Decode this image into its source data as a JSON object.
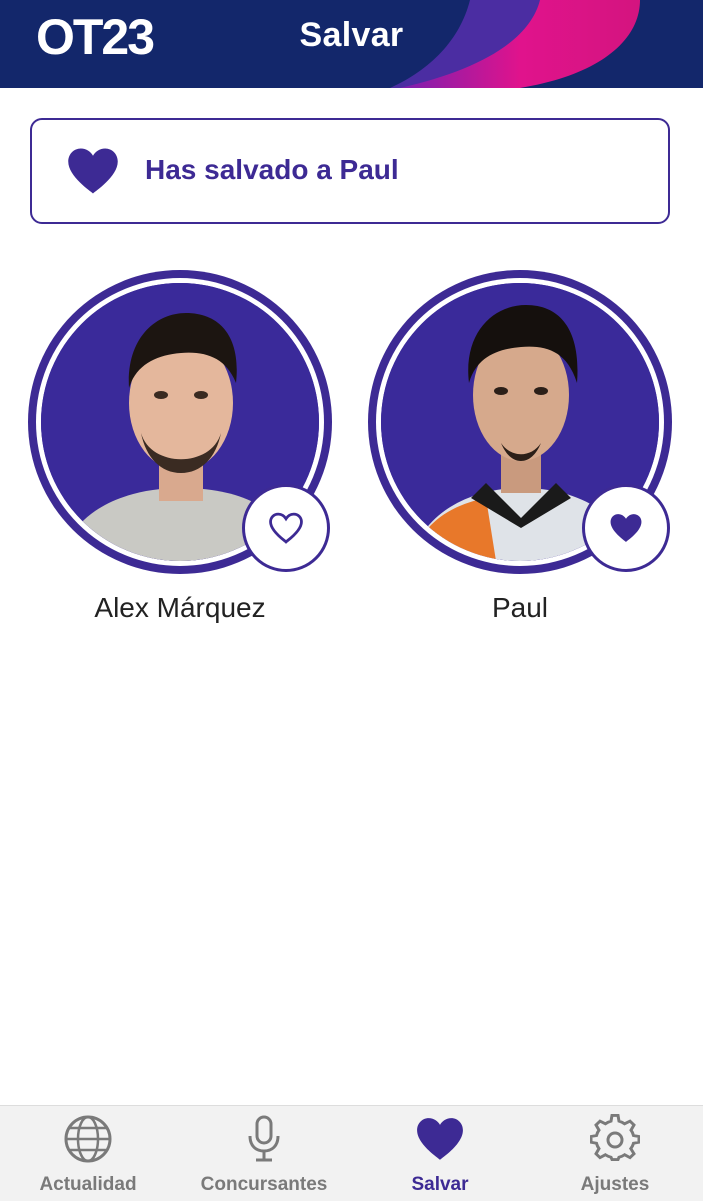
{
  "header": {
    "logo_text": "OT23",
    "title": "Salvar"
  },
  "banner": {
    "icon": "heart-filled-icon",
    "text": "Has salvado a Paul"
  },
  "contestants": [
    {
      "name": "Alex Márquez",
      "favorite_icon": "heart-outline-icon",
      "saved": false
    },
    {
      "name": "Paul",
      "favorite_icon": "heart-filled-icon",
      "saved": true
    }
  ],
  "bottom_nav": {
    "items": [
      {
        "label": "Actualidad",
        "icon": "globe-icon",
        "active": false
      },
      {
        "label": "Concursantes",
        "icon": "microphone-icon",
        "active": false
      },
      {
        "label": "Salvar",
        "icon": "heart-icon",
        "active": true
      },
      {
        "label": "Ajustes",
        "icon": "gear-icon",
        "active": false
      }
    ]
  },
  "colors": {
    "brand_purple": "#3d2a94",
    "header_navy": "#13276b",
    "header_accent_pink": "#e0138c",
    "nav_inactive": "#7a7a7a"
  }
}
